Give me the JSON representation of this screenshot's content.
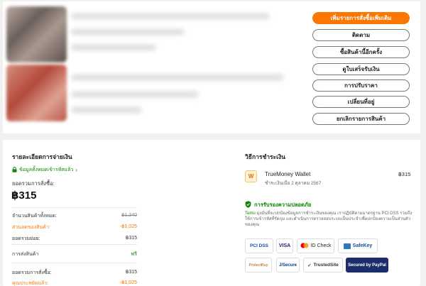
{
  "actions": {
    "buy_more": "เพิ่มรายการสั่งซื้อเพิ่มเติม",
    "track": "ติดตาม",
    "buy_again": "ซื้อสินค้านี้อีกครั้ง",
    "receipt": "ดูใบเสร็จรับเงิน",
    "price_adjust": "การปรับราคา",
    "change_address": "เปลี่ยนที่อยู่",
    "cancel_items": "ยกเลิกรายการสินค้า"
  },
  "payment_details": {
    "title": "รายละเอียดการจ่ายเงิน",
    "secure_note": "ข้อมูลทั้งหมดเข้ารหัสแล้ว",
    "order_total_label": "ยอดรวมการสั่งซื้อ:",
    "order_total": "฿315",
    "rows": [
      {
        "label": "จำนวนสินค้าทั้งหมด:",
        "value": "฿1,340",
        "style": "strike"
      },
      {
        "label": "ส่วนลดของสินค้า:",
        "value": "-฿1,025",
        "style": "orange"
      },
      {
        "label": "ยอดรวมย่อย:",
        "value": "฿315",
        "style": ""
      },
      {
        "label": "การส่งสินค้า",
        "value": "ฟรี",
        "style": "green"
      },
      {
        "label": "ยอดรวมการสั่งซื้อ:",
        "value": "฿315",
        "style": ""
      },
      {
        "label": "คุณประหยัดแล้ว:",
        "value": "-฿1,025",
        "style": "orange"
      }
    ]
  },
  "payment_method": {
    "title": "วิธีการชำระเงิน",
    "wallet_name": "TrueMoney Wallet",
    "paid_date": "ชำระเงินเมื่อ 2 ตุลาคม 2567",
    "amount": "฿315"
  },
  "protection": {
    "title": "การรับรองความปลอดภัย",
    "brand": "Temu",
    "text": " มุ่งมั่นที่จะปกป้องข้อมูลการชำระเงินของคุณ เราปฏิบัติตามมาตรฐาน PCI DSS รวมถึงใช้การเข้ารหัสที่รัดกุม และดำเนินการตรวจสอบระบบเป็นประจำเพื่อปกป้องความเป็นส่วนตัวของคุณ",
    "badges": [
      "PCI DSS",
      "VISA",
      "ID Check",
      "SafeKey",
      "ProtectBuy",
      "J/Secure",
      "TrustedSite",
      "Secured by PayPal"
    ]
  },
  "colors": {
    "accent": "#fb7701",
    "green": "#0a8800"
  }
}
